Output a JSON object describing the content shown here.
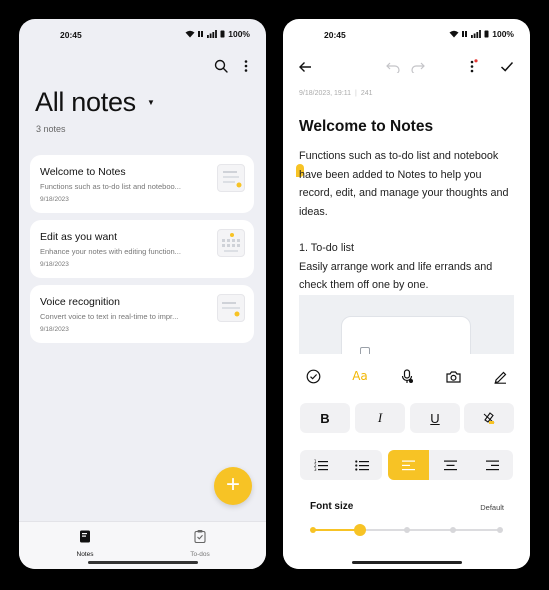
{
  "left_screen": {
    "status": {
      "time": "20:45",
      "battery": "100%"
    },
    "page_title": "All notes",
    "note_count": "3 notes",
    "notes": [
      {
        "title": "Welcome to Notes",
        "preview": "Functions such as to-do list and noteboo...",
        "date": "9/18/2023"
      },
      {
        "title": "Edit as you want",
        "preview": "Enhance your notes with editing function...",
        "date": "9/18/2023"
      },
      {
        "title": "Voice recognition",
        "preview": "Convert voice to text in real-time to impr...",
        "date": "9/18/2023"
      }
    ],
    "fab_label": "+",
    "nav": [
      {
        "label": "Notes",
        "active": true
      },
      {
        "label": "To-dos",
        "active": false
      }
    ]
  },
  "right_screen": {
    "status": {
      "time": "20:45",
      "battery": "100%"
    },
    "meta": {
      "date": "9/18/2023, 19:11",
      "chars": "241"
    },
    "doc_title": "Welcome to Notes",
    "doc_para1": "Functions such as to-do list and notebook have been added to Notes to help you record, edit, and manage your thoughts and ideas.",
    "doc_heading": "1. To-do list",
    "doc_para2": "Easily arrange work and life errands and check them off one by one.",
    "format_tools": [
      "checklist-icon",
      "text-format-icon",
      "voice-input-icon",
      "camera-icon",
      "handwriting-icon"
    ],
    "text_format_label": "Aa",
    "styles": {
      "bold": "B",
      "italic": "I",
      "underline": "U"
    },
    "alignment_selected": "left",
    "font_size": {
      "label": "Font size",
      "value": "Default",
      "level": 1,
      "levels": 5
    }
  },
  "colors": {
    "accent": "#f7c325",
    "background_list": "#eeeff4",
    "card": "#ffffff"
  }
}
